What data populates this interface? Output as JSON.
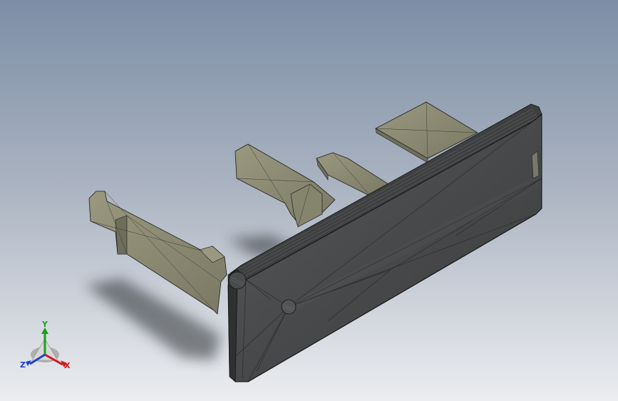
{
  "viewport": {
    "colors": {
      "background_top": "#7c8ea6",
      "background_bottom": "#ebedf0",
      "part_body": "#4b4c4d",
      "part_edge": "#1b1b1b",
      "rib_fill": "#8b8a73",
      "rib_shade": "#6f6e5b",
      "shadow": "#2a2d33"
    }
  },
  "triad": {
    "labels": {
      "x": "X",
      "y": "Y",
      "z": "Z"
    },
    "colors": {
      "x": "#d01818",
      "y": "#1aa01a",
      "z": "#1d3fd0"
    }
  }
}
